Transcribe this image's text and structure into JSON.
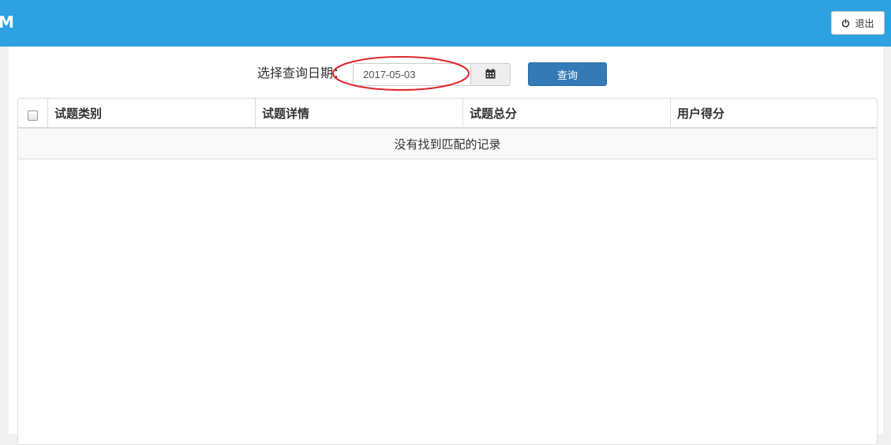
{
  "header": {
    "brand": "M",
    "logout_label": "退出",
    "logout_icon": "power-icon",
    "accent_color": "#2ea1e2"
  },
  "query": {
    "label": "选择查询日期：",
    "date_value": "2017-05-03",
    "calendar_icon": "calendar-icon",
    "search_label": "查询",
    "highlight_color": "#e0262c"
  },
  "table": {
    "columns": [
      "试题类别",
      "试题详情",
      "试题总分",
      "用户得分"
    ],
    "empty_message": "没有找到匹配的记录"
  }
}
